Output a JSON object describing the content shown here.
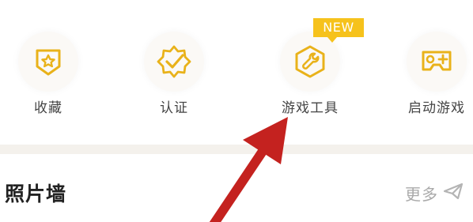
{
  "quick_actions": [
    {
      "label": "收藏",
      "icon": "favorites-star-shield-icon"
    },
    {
      "label": "认证",
      "icon": "verify-badge-check-icon"
    },
    {
      "label": "游戏工具",
      "icon": "wrench-hexagon-icon",
      "badge": "NEW"
    },
    {
      "label": "启动游戏",
      "icon": "gamepad-icon"
    }
  ],
  "photo_wall": {
    "title": "照片墙",
    "more_label": "更多"
  },
  "colors": {
    "accent": "#f6c21c",
    "icon_stroke": "#e9b21a",
    "arrow": "#c4221f",
    "label": "#444444",
    "muted": "#a9a9a9"
  }
}
